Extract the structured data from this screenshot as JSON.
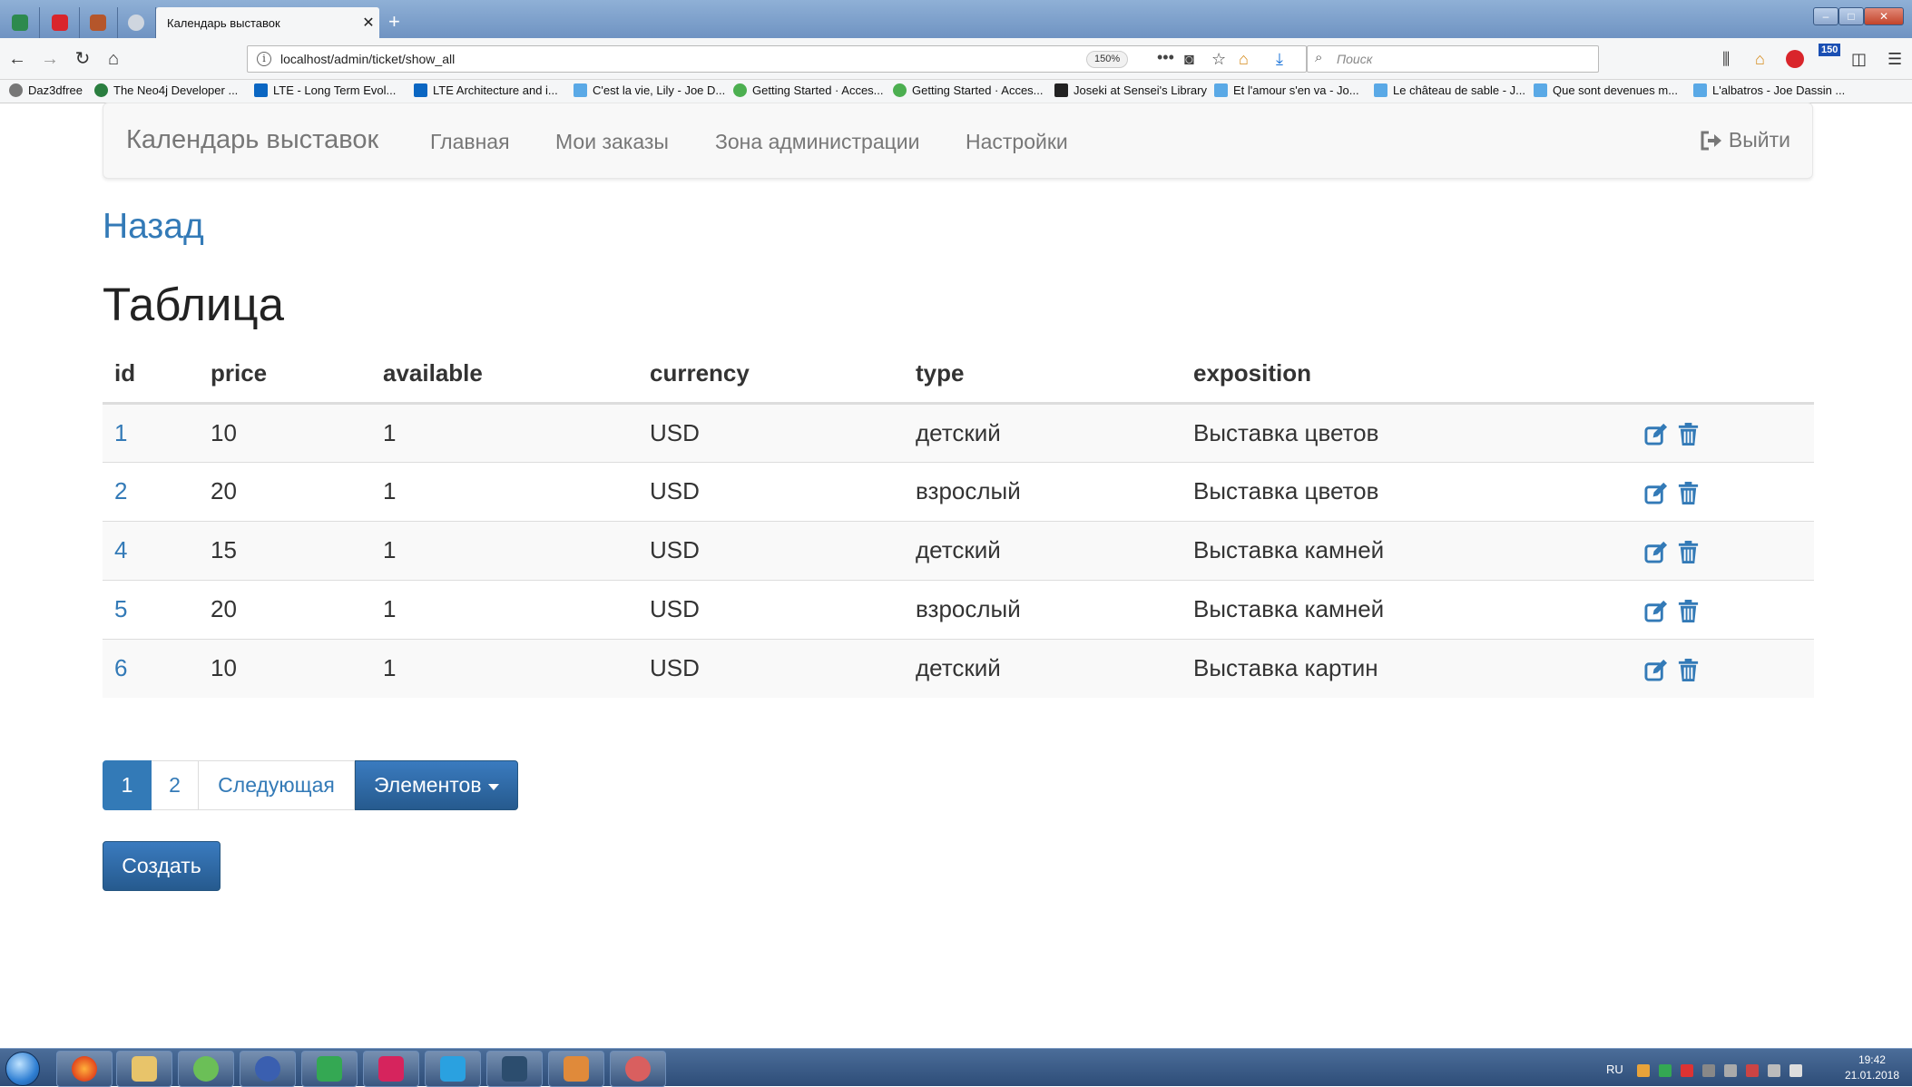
{
  "browser": {
    "tab_title": "Календарь выставок",
    "tab_close": "✕",
    "new_tab": "+",
    "url": "localhost/admin/ticket/show_all",
    "zoom": "150%",
    "search_placeholder": "Поиск",
    "icons": [
      "back-icon",
      "forward-icon",
      "reload-icon",
      "home-icon",
      "page-actions-icon",
      "pocket-icon",
      "bookmark-star-icon",
      "downloads-icon",
      "library-icon",
      "sidebar-icon",
      "menu-icon"
    ],
    "downloads_badge": "150",
    "bookmarks": [
      "Daz3dfree",
      "The Neo4j Developer ...",
      "LTE - Long Term Evol...",
      "LTE Architecture and i...",
      "C'est la vie, Lily - Joe D...",
      "Getting Started · Acces...",
      "Getting Started · Acces...",
      "Joseki at Sensei's Library",
      "Et l'amour s'en va - Jo...",
      "Le château de sable - J...",
      "Que sont devenues m...",
      "L'albatros - Joe Dassin ..."
    ]
  },
  "app": {
    "brand": "Календарь выставок",
    "nav": [
      "Главная",
      "Мои заказы",
      "Зона администрации",
      "Настройки"
    ],
    "logout": "Выйти",
    "back": "Назад",
    "title": "Таблица",
    "table": {
      "headers": [
        "id",
        "price",
        "available",
        "currency",
        "type",
        "exposition"
      ],
      "rows": [
        [
          "1",
          "10",
          "1",
          "USD",
          "детский",
          "Выставка цветов"
        ],
        [
          "2",
          "20",
          "1",
          "USD",
          "взрослый",
          "Выставка цветов"
        ],
        [
          "4",
          "15",
          "1",
          "USD",
          "детский",
          "Выставка камней"
        ],
        [
          "5",
          "20",
          "1",
          "USD",
          "взрослый",
          "Выставка камней"
        ],
        [
          "6",
          "10",
          "1",
          "USD",
          "детский",
          "Выставка картин"
        ]
      ]
    },
    "pagination": {
      "pages": [
        "1",
        "2"
      ],
      "next": "Следующая",
      "items_dropdown": "Элементов"
    },
    "create": "Создать",
    "colors": {
      "link": "#337ab7",
      "primary": "#337ab7",
      "primary_dark": "#265a8e"
    }
  },
  "taskbar": {
    "language": "RU",
    "time": "19:42",
    "date": "21.01.2018"
  }
}
